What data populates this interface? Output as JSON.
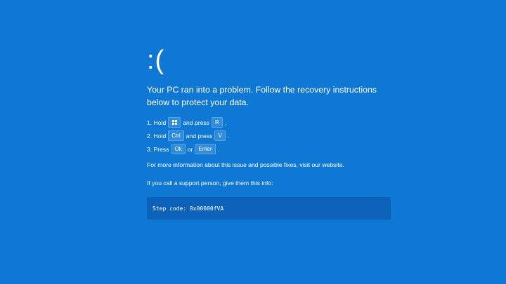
{
  "screen": {
    "background_color": "#0F78D4",
    "panel_color": "#0B62B8"
  },
  "sad_face": ":(",
  "headline": "Your PC ran into a problem. Follow the recovery instructions below to protect your data.",
  "steps": [
    {
      "prefix": "1. Hold",
      "key1": "windows-logo-icon",
      "middle": "and press",
      "key2": "R",
      "suffix": "."
    },
    {
      "prefix": "2. Hold",
      "key1": "Ctrl",
      "middle": "and press",
      "key2": "V",
      "suffix": "."
    },
    {
      "prefix": "3. Press",
      "key1": "Ok",
      "middle": "or",
      "key2": "Enter",
      "suffix": "."
    }
  ],
  "more_info": "For more information about this issue and possible fixes, visit our website.",
  "support_text": "If you call a support person, give them this info:",
  "step_code": "Step code: 0x00000fVA"
}
